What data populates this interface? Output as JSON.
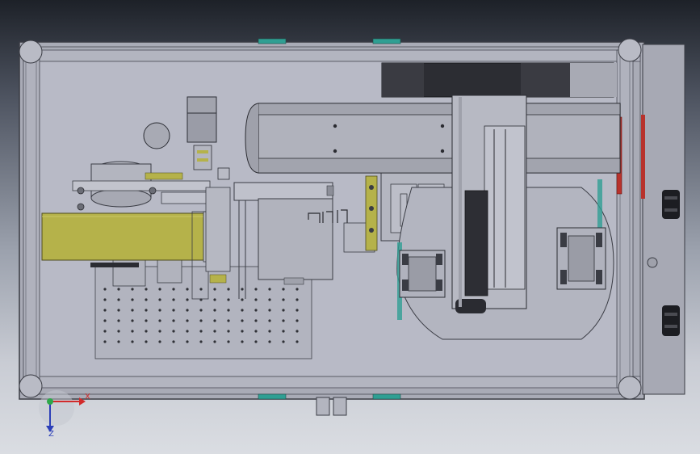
{
  "viewport": {
    "background_top": "#1d2128",
    "background_bottom": "#dadde2",
    "tray_color": "#b8bac6",
    "frame_color": "#a9abb6",
    "belt_color": "#b5b24a",
    "accent_red": "#b8322c",
    "teal_accent": "#2f9f93"
  },
  "triad": {
    "x_label": "X",
    "z_label": "Z",
    "x_color": "#d22b2b",
    "y_color": "#2ea84a",
    "z_color": "#2c3fb8"
  },
  "model": {
    "parts": [
      "outer-frame",
      "side-panel",
      "conveyor-belt",
      "belt-pulley",
      "stepper-motor",
      "linear-gantry",
      "vertical-axis",
      "perforated-plate",
      "rotary-table",
      "part-fixture",
      "housing-box"
    ]
  }
}
